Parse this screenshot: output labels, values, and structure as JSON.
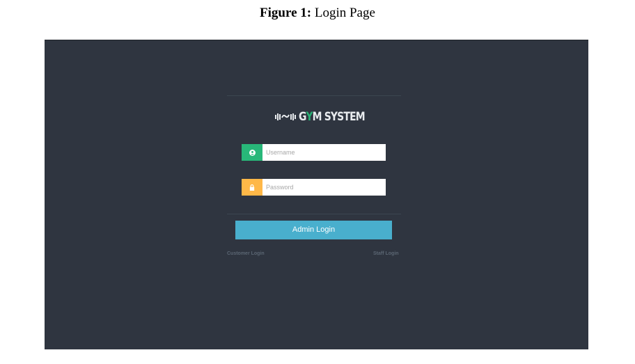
{
  "caption": {
    "label": "Figure 1:",
    "text": " Login Page"
  },
  "logo": {
    "icon": "dumbbell-icon",
    "text_before": "G",
    "text_accent": "Y",
    "text_after": "M SYSTEM",
    "accent_color": "#27b174"
  },
  "login_form": {
    "username": {
      "icon": "user-circle-icon",
      "placeholder": "Username",
      "value": "",
      "color": "#28b779"
    },
    "password": {
      "icon": "lock-icon",
      "placeholder": "Password",
      "value": "",
      "color": "#ffb848"
    },
    "submit_label": "Admin Login",
    "submit_color": "#49afcd"
  },
  "links": {
    "customer": "Customer Login",
    "staff": "Staff Login"
  },
  "theme": {
    "background": "#2f3540"
  }
}
